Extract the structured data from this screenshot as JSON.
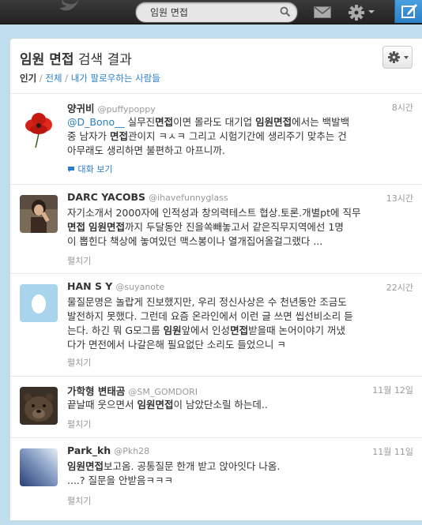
{
  "search": {
    "value": "임원 면접"
  },
  "header": {
    "title_query": "임원 면접",
    "title_suffix": " 검색 결과",
    "filter_top": "인기",
    "filter_sep1": " / ",
    "filter_all": "전체",
    "filter_sep2": " / ",
    "filter_following": "내가 팔로우하는 사람들"
  },
  "tweets": [
    {
      "name": "양귀비",
      "handle": "@puffypoppy",
      "time": "8시간",
      "p1_mention": "@D_Bono__",
      "p1a": " 실무진",
      "p1b": "면접",
      "p1c": "이면 몰라도 대기업 ",
      "p1d": "임원면접",
      "p1e": "에서는 백발백",
      "p2a": "중 남자가 ",
      "p2b": "면접",
      "p2c": "관이지 ㅋㅅㅋ 그리고 시험기간에 생리주기 맞추는 건",
      "p3": "아무래도 생리하면 불편하고 아프니까.",
      "action": "대화 보기"
    },
    {
      "name": "DARC YACOBS",
      "handle": "@ihavefunnyglass",
      "time": "13시간",
      "l1": "자기소개서 2000자에 인적성과 창의력테스트 협상.토론.개별pt에 직무",
      "l2a": "면접",
      "l2b": " ",
      "l2c": "임원면접",
      "l2d": "까지 두달동안 진을쏙빼놓고서 같은직무지역에선 1명",
      "l3": "이 뽑힌다 책상에 놓여있던 맥스봉이나 열개집어올걸그랬다 ...",
      "action": "펼치기"
    },
    {
      "name": "HAN S Y",
      "handle": "@suyanote",
      "time": "22시간",
      "l1": "물질문명은 놀랍게 진보했지만, 우리 정신사상은 수 천년동안 조금도",
      "l2": "발전하지 못했다. 그런데 요즘 온라인에서 이런 글 쓰면 씹선비소리 듣",
      "l3a": "는다. 하긴 뭐 G모그룹 ",
      "l3b": "임원",
      "l3c": "앞에서 인성",
      "l3d": "면접",
      "l3e": "받을때 논어이야기 꺼냈",
      "l4": "다가 면전에서 나갈은해 필요없단 소리도 들었으니 ㅋ",
      "action": "펼치기"
    },
    {
      "name": "가학형 변태곰",
      "handle": "@SM_GOMDORI",
      "time": "11월 12일",
      "l1a": "끝날때 웃으면서 ",
      "l1b": "임원면접",
      "l1c": "이 남았단소릴 하는데..",
      "action": "펼치기"
    },
    {
      "name": "Park_kh",
      "handle": "@Pkh28",
      "time": "11월 11일",
      "l1a": "임원면접",
      "l1b": "보고옴. 공통질문 한개 받고 앉아잇다 나옴.",
      "l2": "....? 질문을 안받음ㅋㅋㅋ",
      "action": "펼치기"
    }
  ],
  "colors": {
    "link": "#2a7fc8",
    "topbar": "#2b2b2b",
    "background": "#c0deed"
  }
}
